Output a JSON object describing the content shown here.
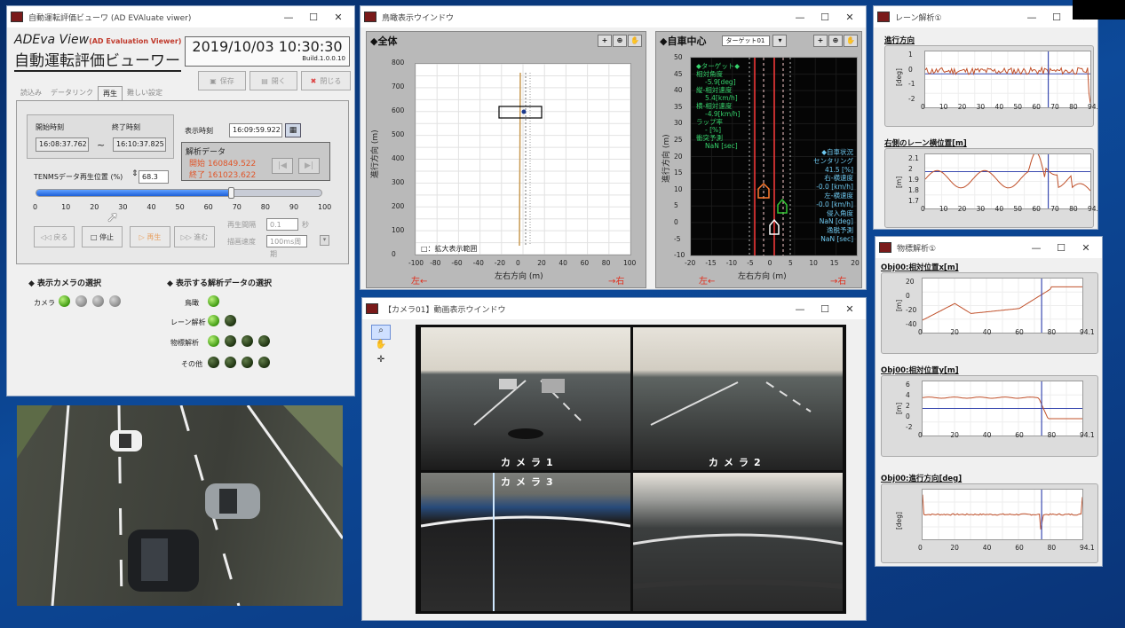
{
  "main_window": {
    "title": "自動運転評価ビューワ (AD EVAluate viwer)",
    "brand_line1": "ADEva View",
    "brand_line1_suffix": "(AD Evaluation Viewer)",
    "brand_line2": "自動運転評価ビューワー",
    "datetime": "2019/10/03 10:30:30",
    "build": "Build.1.0.0.10",
    "toolbar": {
      "save": "保存",
      "open": "開く",
      "close": "閉じる"
    },
    "tabs": [
      "読込み",
      "データリンク",
      "再生",
      "難しい設定"
    ],
    "start_time_label": "開始時刻",
    "start_time": "16:08:37.762",
    "end_time_label": "終了時刻",
    "end_time": "16:10:37.825",
    "tilde": "~",
    "display_time_label": "表示時刻",
    "display_time": "16:09:59.922",
    "analysis_label": "解析データ",
    "analysis_start": "開始 160849.522",
    "analysis_end": "終了 161023.622",
    "playback_label": "TENMSデータ再生位置 (%)",
    "playback_value": "68.3",
    "slider_level_percent": 68.3,
    "slider_ticks": [
      "0",
      "10",
      "20",
      "30",
      "40",
      "50",
      "60",
      "70",
      "80",
      "90",
      "100"
    ],
    "buttons": {
      "back": "戻る",
      "stop": "停止",
      "play": "再生",
      "forward": "進む"
    },
    "interval_label": "再生間隔",
    "interval_value": "0.1",
    "interval_unit": "秒",
    "draw_speed_label": "描画速度",
    "draw_speed_value": "100ms周期",
    "camera_select_label": "◆ 表示カメラの選択",
    "camera_label": "カメラ",
    "analysis_select_label": "◆ 表示する解析データの選択",
    "analysis_rows": [
      "鳥瞰",
      "レーン解析",
      "物標解析",
      "その他"
    ]
  },
  "birdseye_window": {
    "title": "鳥瞰表示ウインドウ",
    "overall_label": "◆全体",
    "ego_label": "◆自車中心",
    "target_select": "ターゲット01",
    "left_label": "左←",
    "right_label": "→右",
    "left_label2": "左←",
    "right_label2": "→右",
    "y_axis_label": "進行方向 (m)",
    "x_axis_label": "左右方向 (m)",
    "zoom_legend": "□：拡大表示範囲",
    "overall_yticks": [
      "800",
      "700",
      "600",
      "500",
      "400",
      "300",
      "200",
      "100",
      "0"
    ],
    "overall_xticks": [
      "-100",
      "-80",
      "-60",
      "-40",
      "-20",
      "0",
      "20",
      "40",
      "60",
      "80",
      "100"
    ],
    "ego_yticks": [
      "50",
      "45",
      "40",
      "35",
      "30",
      "25",
      "20",
      "15",
      "10",
      "5",
      "0",
      "-5",
      "-10"
    ],
    "ego_xticks": [
      "-20",
      "-15",
      "-10",
      "-5",
      "0",
      "5",
      "10",
      "15",
      "20"
    ],
    "target_info": [
      "◆ターゲット◆",
      "相対角度",
      "-5.9[deg]",
      "縦-相対速度",
      "5.4[km/h]",
      "横-相対速度",
      "-4.9[km/h]",
      "ラップ率",
      "- [%]",
      "衝突予測",
      "NaN [sec]"
    ],
    "ego_info": [
      "◆自車状況",
      "センタリング",
      "41.5 [%]",
      "右-横速度",
      "-0.0 [km/h]",
      "左-横速度",
      "-0.0 [km/h]",
      "侵入角度",
      "NaN [deg]",
      "逸脱予測",
      "NaN [sec]"
    ]
  },
  "video_window": {
    "title": "【カメラ01】動画表示ウインドウ",
    "cam1": "カメラ1",
    "cam2": "カメラ2",
    "cam3": "カメラ3"
  },
  "lane_window": {
    "title": "レーン解析①",
    "chart1_title": "進行方向",
    "chart1_unit": "[deg]",
    "chart1_yticks": [
      "1",
      "0",
      "-1",
      "-2"
    ],
    "chart2_title": "右側のレーン横位置[m]",
    "chart2_unit": "[m]",
    "chart2_yticks": [
      "2.1",
      "2",
      "1.9",
      "1.8",
      "1.7"
    ],
    "xticks": [
      "0",
      "10",
      "20",
      "30",
      "40",
      "50",
      "60",
      "70",
      "80",
      "94.1"
    ]
  },
  "object_window": {
    "title": "物標解析①",
    "chart1_title": "Obj00:相対位置x[m]",
    "chart1_unit": "[m]",
    "chart1_yticks": [
      "20",
      "0",
      "-20",
      "-40"
    ],
    "chart2_title": "Obj00:相対位置y[m]",
    "chart2_unit": "[m]",
    "chart2_yticks": [
      "6",
      "4",
      "2",
      "0",
      "-2"
    ],
    "chart3_title": "Obj00:進行方向[deg]",
    "chart3_unit": "[deg]",
    "xticks": [
      "0",
      "20",
      "40",
      "60",
      "80",
      "94.1"
    ]
  },
  "colors": {
    "accent_green": "#34c534",
    "curve": "#c0502a",
    "cursor": "#3a4ab0"
  }
}
